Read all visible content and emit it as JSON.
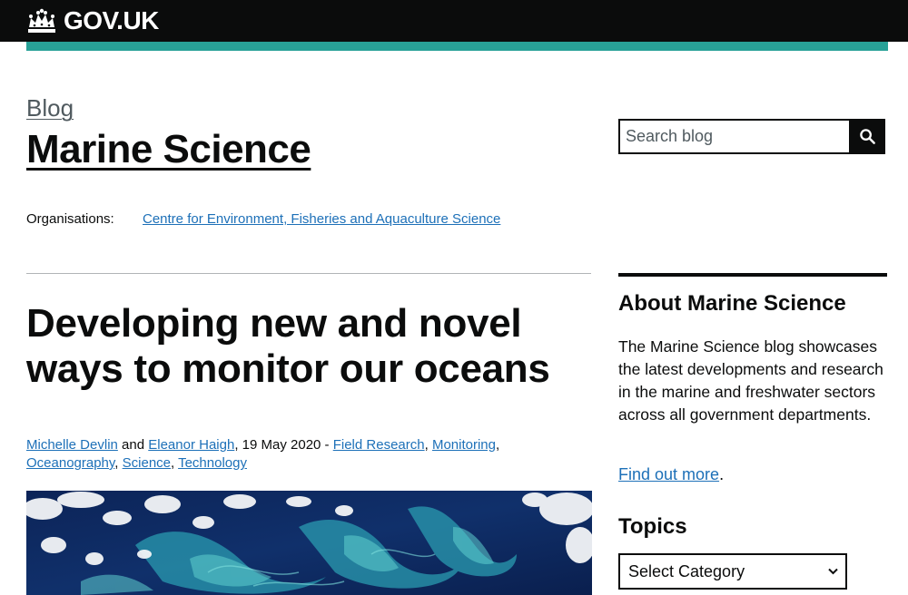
{
  "header": {
    "logo_text": "GOV.UK",
    "logo_icon": "crown-icon",
    "accent_color": "#28a197"
  },
  "blog": {
    "breadcrumb": "Blog",
    "title": "Marine Science"
  },
  "search": {
    "placeholder": "Search blog",
    "button_icon": "search-icon"
  },
  "organisations": {
    "label": "Organisations:",
    "link": "Centre for Environment, Fisheries and Aquaculture Science"
  },
  "post": {
    "title": "Developing new and novel ways to monitor our oceans",
    "authors": [
      "Michelle Devlin",
      "Eleanor Haigh"
    ],
    "and": "and",
    "date": ", 19 May 2020 - ",
    "tags": [
      "Field Research",
      "Monitoring",
      "Oceanography",
      "Science",
      "Technology"
    ]
  },
  "sidebar": {
    "about_heading": "About Marine Science",
    "about_text": "The Marine Science blog showcases the latest developments and research in the marine and freshwater sectors across all government departments.",
    "find_out_link": "Find out more",
    "find_out_suffix": ".",
    "topics_heading": "Topics",
    "topics_select": "Select Category"
  }
}
